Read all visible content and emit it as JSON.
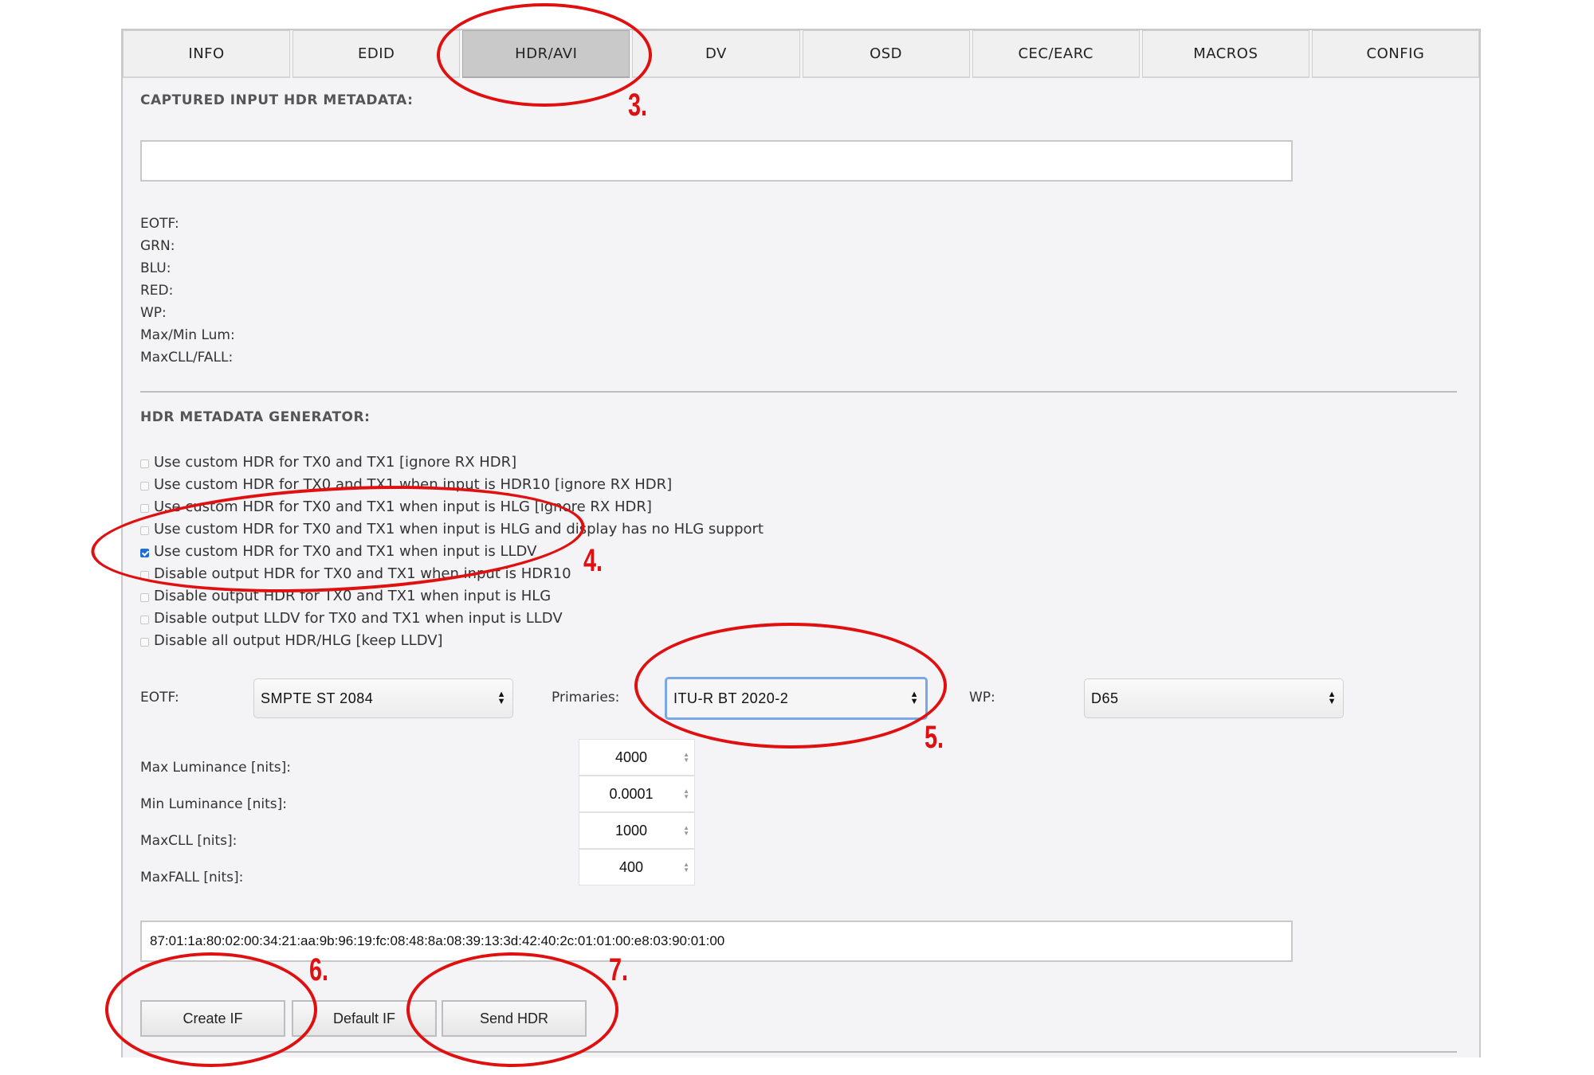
{
  "tabs": [
    {
      "label": "INFO"
    },
    {
      "label": "EDID"
    },
    {
      "label": "HDR/AVI"
    },
    {
      "label": "DV"
    },
    {
      "label": "OSD"
    },
    {
      "label": "CEC/EARC"
    },
    {
      "label": "MACROS"
    },
    {
      "label": "CONFIG"
    }
  ],
  "active_tab": "HDR/AVI",
  "captured": {
    "title": "CAPTURED INPUT HDR METADATA:",
    "value": "",
    "fields": [
      "EOTF:",
      "GRN:",
      "BLU:",
      "RED:",
      "WP:",
      "Max/Min Lum:",
      "MaxCLL/FALL:"
    ]
  },
  "generator": {
    "title": "HDR METADATA GENERATOR:",
    "options": [
      {
        "label": "Use custom HDR for TX0 and TX1 [ignore RX HDR]",
        "checked": false
      },
      {
        "label": "Use custom HDR for TX0 and TX1 when input is HDR10 [ignore RX HDR]",
        "checked": false
      },
      {
        "label": "Use custom HDR for TX0 and TX1 when input is HLG [ignore RX HDR]",
        "checked": false
      },
      {
        "label": "Use custom HDR for TX0 and TX1 when input is HLG and display has no HLG support",
        "checked": false
      },
      {
        "label": "Use custom HDR for TX0 and TX1 when input is LLDV",
        "checked": true
      },
      {
        "label": "Disable output HDR for TX0 and TX1 when input is HDR10",
        "checked": false
      },
      {
        "label": "Disable output HDR for TX0 and TX1 when input is HLG",
        "checked": false
      },
      {
        "label": "Disable output LLDV for TX0 and TX1 when input is LLDV",
        "checked": false
      },
      {
        "label": "Disable all output HDR/HLG [keep LLDV]",
        "checked": false
      }
    ],
    "eotf_label": "EOTF:",
    "eotf_value": "SMPTE ST 2084",
    "primaries_label": "Primaries:",
    "primaries_value": "ITU-R BT 2020-2",
    "wp_label": "WP:",
    "wp_value": "D65",
    "luminance": [
      {
        "label": "Max Luminance [nits]:",
        "value": "4000"
      },
      {
        "label": "Min Luminance [nits]:",
        "value": "0.0001"
      },
      {
        "label": "MaxCLL [nits]:",
        "value": "1000"
      },
      {
        "label": "MaxFALL [nits]:",
        "value": "400"
      }
    ],
    "infoframe": "87:01:1a:80:02:00:34:21:aa:9b:96:19:fc:08:48:8a:08:39:13:3d:42:40:2c:01:01:00:e8:03:90:01:00"
  },
  "buttons": {
    "create": "Create IF",
    "default": "Default IF",
    "send": "Send HDR"
  },
  "annotations": [
    "3.",
    "4.",
    "5.",
    "6.",
    "7."
  ],
  "colors": {
    "annotation": "#e01010",
    "checkbox_checked": "#1f6fd6",
    "focus_ring": "#7aa7e8",
    "active_tab": "#c9c9c9"
  }
}
